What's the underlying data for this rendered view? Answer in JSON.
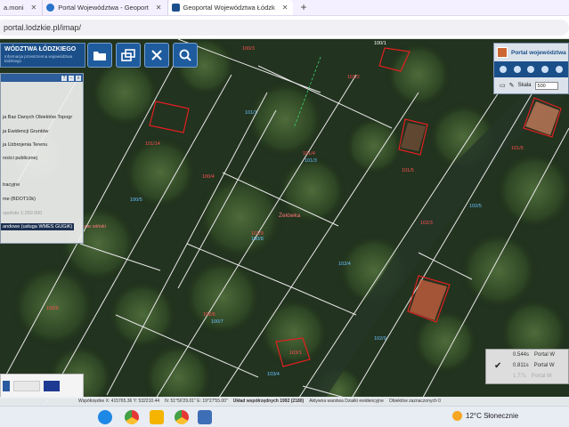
{
  "browser": {
    "tabs": [
      {
        "label": "a.moni",
        "active": false
      },
      {
        "label": "Portal Województwa - Geoport",
        "active": false
      },
      {
        "label": "Geoportal Województwa Łódzk",
        "active": true
      }
    ],
    "new_tab": "+",
    "url": "portal.lodzkie.pl/imap/"
  },
  "header": {
    "title": "WÓDZTWA ŁÓDZKIEGO",
    "subtitle": "Informacja przestrzenna województwa łódzkiego"
  },
  "toolbar": {
    "buttons": [
      "folder-icon",
      "windows-icon",
      "tools-icon",
      "search-icon"
    ]
  },
  "layer_panel": {
    "items": [
      {
        "label": "ja Baz Danych Obiektów Topogr",
        "state": "normal"
      },
      {
        "label": "ja Ewidencji Gruntów",
        "state": "normal"
      },
      {
        "label": "ja Uzbrojenia Terenu",
        "state": "normal"
      },
      {
        "label": "ności publicznej",
        "state": "normal"
      },
      {
        "label": "tracyjne",
        "state": "normal"
      },
      {
        "label": "me (BDOT10k)",
        "state": "normal"
      },
      {
        "label": "opofoto 1:250 000",
        "state": "dim"
      },
      {
        "label": "andowe (usługa WMES GUGiK)",
        "state": "selected"
      }
    ]
  },
  "right_panel": {
    "title": "Portal województwa",
    "scale_label": "Skala",
    "scale_value": "500"
  },
  "map_labels": {
    "parcels": [
      "100/3",
      "100/1",
      "100/4",
      "100/5",
      "101/4",
      "101/3",
      "101/2",
      "101/1",
      "101/5",
      "101/9",
      "102/5",
      "102/4",
      "102/9",
      "102/3",
      "103/1",
      "103/4",
      "100/6",
      "100/7",
      "101/14",
      "100/8",
      "101/6",
      "102/6"
    ],
    "place_name": "Żelówka",
    "street": "szar wiński"
  },
  "legend": {
    "rows": [
      {
        "value": "0.544s",
        "label": "Portal W"
      },
      {
        "value": "0.811s",
        "label": "Portal W"
      },
      {
        "value": "1.77s",
        "label": "Portal W"
      }
    ]
  },
  "status_bar": {
    "coords": "Współrzędne X: 415765.36  Y: 532210.44",
    "geo": "N: 51°56'29.01\"  E: 19°27'55.00\"",
    "crs": "Układ współrzędnych 1992 (2180)",
    "active_layer": "Aktywna warstwa Działki ewidencyjne",
    "selected": "Obiektów zaznaczonych 0"
  },
  "taskbar": {
    "weather": "12°C  Słonecznie"
  }
}
